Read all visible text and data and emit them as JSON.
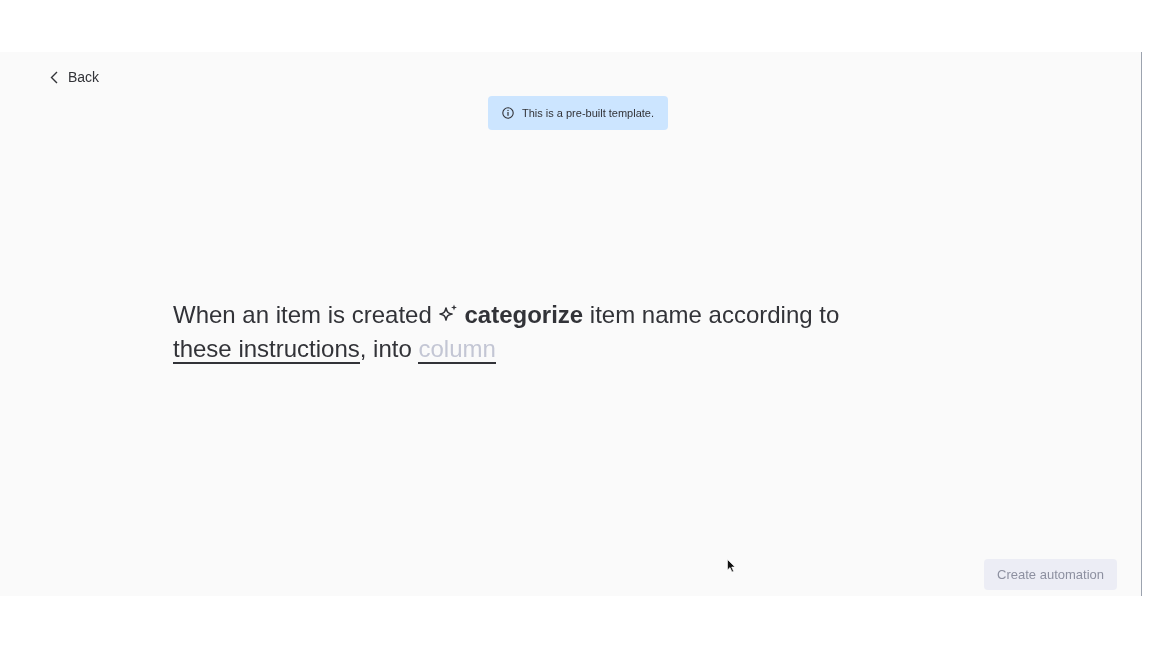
{
  "back_link": {
    "label": "Back"
  },
  "notice": {
    "text": "This is a pre-built template."
  },
  "sentence": {
    "lines": [
      [
        {
          "kind": "text",
          "text": "When an item is created "
        },
        {
          "kind": "action",
          "text": "categorize"
        },
        {
          "kind": "text",
          "text": " item name according to"
        }
      ],
      [
        {
          "kind": "field",
          "value": "these instructions"
        },
        {
          "kind": "text",
          "text": ", into "
        },
        {
          "kind": "field",
          "placeholder": "column"
        }
      ]
    ]
  },
  "create_button": {
    "label": "Create automation",
    "disabled": true
  }
}
